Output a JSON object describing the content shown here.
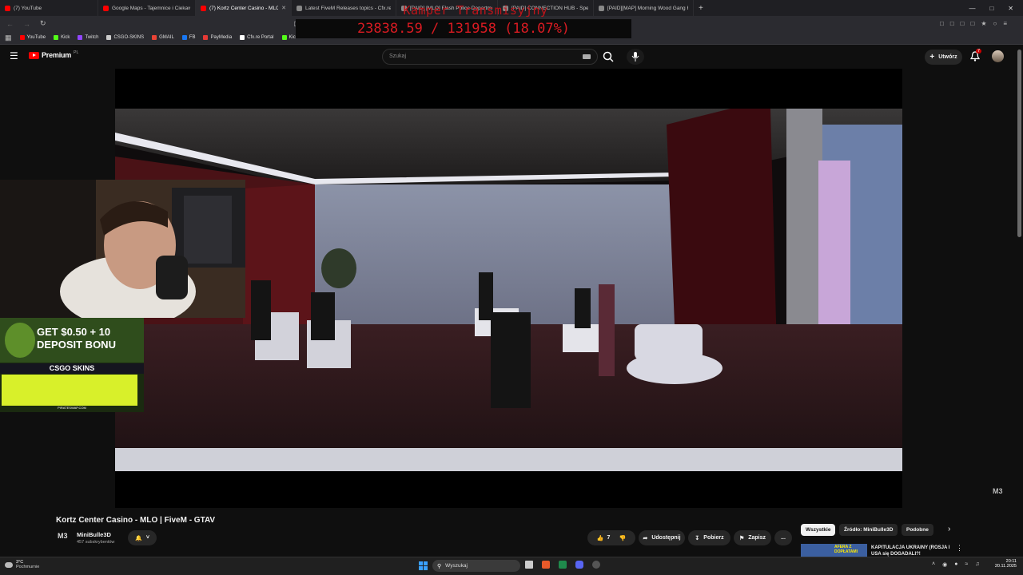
{
  "browser": {
    "tabs": [
      {
        "label": "(7) YouTube",
        "color": "#ff0000"
      },
      {
        "label": "Google Maps - Tajemnice i Ciekawos",
        "color": "#ff0000"
      },
      {
        "label": "(7) Kortz Center Casino - MLO",
        "color": "#ff0000",
        "active": true
      },
      {
        "label": "Latest FiveM Releases topics - Cfx.re",
        "color": "#888888"
      },
      {
        "label": "[PAID] [MLO] Flash Police Departme",
        "color": "#888888"
      },
      {
        "label": "[PAID] CONNECTION HUB - Speed/S",
        "color": "#888888"
      },
      {
        "label": "[PAID][MAP] Morning Wood Gang H",
        "color": "#888888"
      }
    ],
    "new_tab": "+",
    "bookmarks": [
      {
        "label": "YouTube",
        "color": "#ff0000"
      },
      {
        "label": "Kick",
        "color": "#53fc18"
      },
      {
        "label": "Twitch",
        "color": "#9146ff"
      },
      {
        "label": "CSGO-SKINS",
        "color": "#cccccc"
      },
      {
        "label": "GMAIL",
        "color": "#ea4335"
      },
      {
        "label": "FB",
        "color": "#1877f2"
      },
      {
        "label": "PayMedia",
        "color": "#e53935"
      },
      {
        "label": "Cfx.re Portal",
        "color": "#ffffff"
      },
      {
        "label": "Kick",
        "color": "#53fc18"
      }
    ]
  },
  "stream_overlay": {
    "title": "Kamper Transmisyjny",
    "counter": "23838.59 / 131958 (18.07%)",
    "progress": 0.1807
  },
  "youtube": {
    "logo_text": "Premium",
    "logo_region": "PL",
    "search_placeholder": "Szukaj",
    "create_label": "Utwórz",
    "notification_count": "7"
  },
  "video": {
    "title": "Kortz Center Casino - MLO | FiveM - GTAV",
    "watermark": "M3"
  },
  "ad": {
    "line1": "GET $0.50 + 10",
    "line2": "DEPOSIT BONU",
    "brand": "CSGO SKINS",
    "footer": "PIRATESWAP.COM"
  },
  "channel": {
    "name": "MiniBulle3D",
    "subscribers": "457 subskrybentów"
  },
  "actions": {
    "likes": "7",
    "share": "Udostępnij",
    "download": "Pobierz",
    "save": "Zapisz",
    "more": "..."
  },
  "chips": [
    "Wszystkie",
    "Źródło: MiniBulle3D",
    "Podobne"
  ],
  "recommended": {
    "thumb_text": "AFERA Z DOPŁATAMI",
    "title": "KAPITULACJA UKRAINY (ROSJA I USA się DOGADALI?!"
  },
  "taskbar": {
    "weather_temp": "3°C",
    "weather_desc": "Pochmurnie",
    "search_label": "Wyszukaj",
    "time": "20:11",
    "date": "20.11.2025"
  }
}
